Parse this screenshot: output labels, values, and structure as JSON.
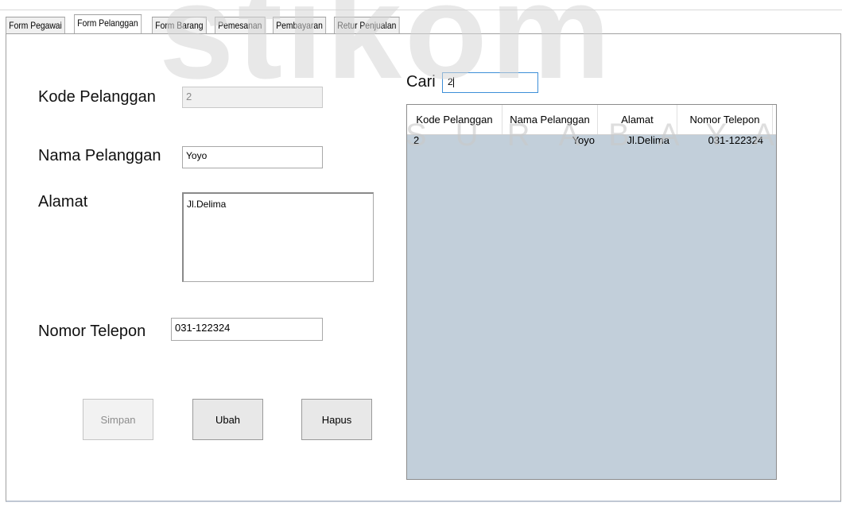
{
  "tabs": [
    {
      "label": "Form Pegawai",
      "active": false
    },
    {
      "label": "Form Pelanggan",
      "active": true
    },
    {
      "label": "Form Barang",
      "active": false
    },
    {
      "label": "Pemesanan",
      "active": false
    },
    {
      "label": "Pembayaran",
      "active": false
    },
    {
      "label": "Retur Penjualan",
      "active": false
    }
  ],
  "watermark": {
    "main": "stikom",
    "sub": "SURABAYA"
  },
  "form": {
    "kode_label": "Kode Pelanggan",
    "kode_value": "2",
    "nama_label": "Nama Pelanggan",
    "nama_value": "Yoyo",
    "alamat_label": "Alamat",
    "alamat_value": "Jl.Delima",
    "telp_label": "Nomor Telepon",
    "telp_value": "031-122324"
  },
  "buttons": {
    "simpan": "Simpan",
    "ubah": "Ubah",
    "hapus": "Hapus"
  },
  "search": {
    "label": "Cari",
    "value": "2"
  },
  "grid": {
    "columns": [
      "Kode Pelanggan",
      "Nama Pelanggan",
      "Alamat",
      "Nomor Telepon"
    ],
    "rows": [
      [
        "2",
        "Yoyo",
        "Jl.Delima",
        "031-122324"
      ]
    ],
    "background": "#c2cfda"
  }
}
